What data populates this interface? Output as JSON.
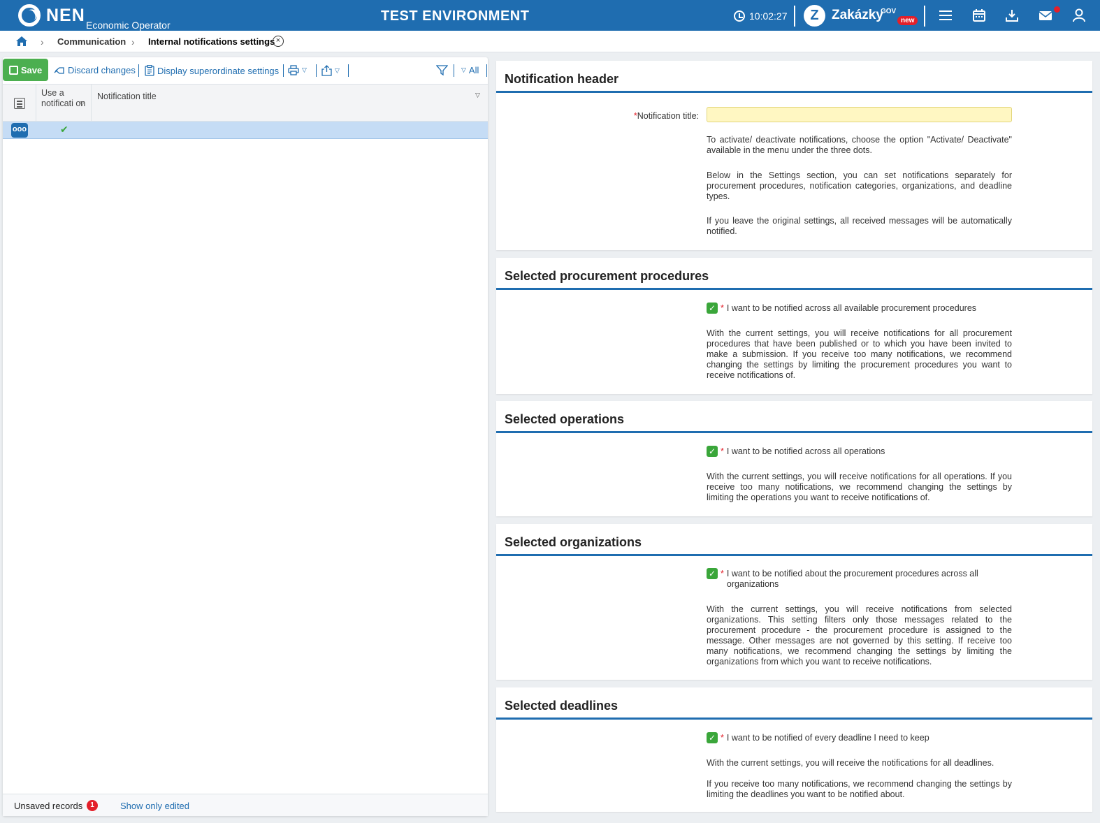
{
  "topbar": {
    "brand": "NEN",
    "brand_sub": "Economic Operator",
    "env_title": "TEST ENVIRONMENT",
    "time": "10:02:27",
    "zakazky": "Zakázky",
    "zakazky_gov": "GOV",
    "zakazky_new": "new",
    "zak_logo_letter": "Z"
  },
  "breadcrumb": {
    "items": [
      "Communication",
      "Internal notifications settings"
    ],
    "close_glyph": "×"
  },
  "toolbar": {
    "save": "Save",
    "discard": "Discard changes",
    "superordinate": "Display superordinate settings",
    "filter_all": "All"
  },
  "grid": {
    "columns": [
      "Use a notificati on",
      "Notification title"
    ],
    "rows": [
      {
        "use": true,
        "title": "",
        "menu_glyph": "ooo",
        "check_glyph": "✔"
      }
    ]
  },
  "footer": {
    "unsaved_label": "Unsaved records",
    "unsaved_count": "1",
    "show_edited": "Show only edited"
  },
  "sections": {
    "header": {
      "title": "Notification header",
      "field_label": "Notification title:",
      "field_value": "",
      "info1": "To activate/ deactivate notifications, choose the option \"Activate/ Deactivate\" available in the menu under the three dots.",
      "info2": "Below in the Settings section, you can set notifications separately for procurement procedures, notification categories, organizations, and deadline types.",
      "info3": "If you leave the original settings, all received messages will be automatically notified."
    },
    "procedures": {
      "title": "Selected procurement procedures",
      "check": "I want to be notified across all available procurement procedures",
      "info": "With the current settings, you will receive notifications for all procurement procedures that have been published or to which you have been invited to make a submission. If you receive too many notifications, we recommend changing the settings by limiting the procurement procedures you want to receive notifications of."
    },
    "operations": {
      "title": "Selected operations",
      "check": "I want to be notified across all operations",
      "info": "With the current settings, you will receive notifications for all operations. If you receive too many notifications, we recommend changing the settings by limiting the operations you want to receive notifications of."
    },
    "organizations": {
      "title": "Selected organizations",
      "check": "I want to be notified about the procurement procedures across all organizations",
      "info": "With the current settings, you will receive notifications from selected organizations. This setting filters only those messages related to the procurement procedure - the procurement procedure is assigned to the message. Other messages are not governed by this setting. If receive too many notifications, we recommend changing the settings by limiting the organizations from which you want to receive notifications."
    },
    "deadlines": {
      "title": "Selected deadlines",
      "check": "I want to be notified of every deadline I need to keep",
      "info1": "With the current settings, you will receive the notifications for all deadlines.",
      "info2": "If you receive too many notifications, we recommend changing the settings by limiting the deadlines you want to be notified about."
    }
  },
  "colors": {
    "brand_blue": "#1f6db0",
    "save_green": "#4caf50",
    "check_green": "#3aa63a",
    "alert_red": "#e3202a",
    "selected_row": "#c5dcf5",
    "required_input": "#fff7c2"
  },
  "icons": [
    "nen-logo-icon",
    "clock-icon",
    "zakazky-logo-icon",
    "menu-icon",
    "calendar-icon",
    "download-icon",
    "mail-icon",
    "user-icon",
    "home-icon",
    "close-icon",
    "save-icon",
    "discard-icon",
    "clipboard-icon",
    "print-icon",
    "export-icon",
    "filter-icon",
    "column-settings-icon"
  ],
  "required_mark": "*",
  "caret_glyph": "▽",
  "chevron_glyph": "›"
}
